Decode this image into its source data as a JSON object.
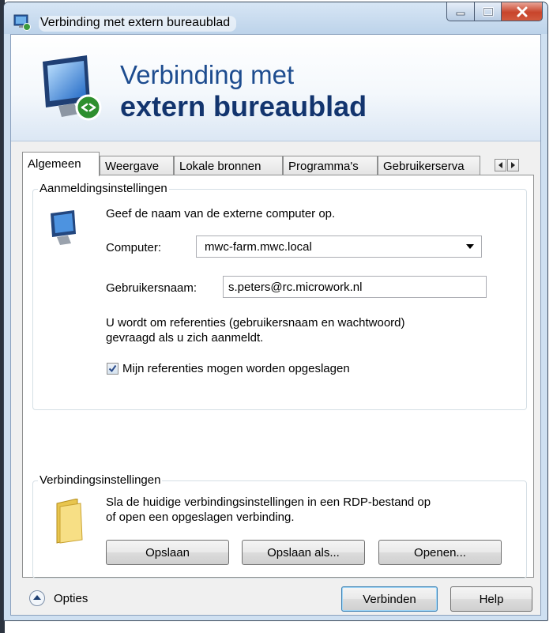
{
  "window": {
    "title": "Verbinding met extern bureaublad"
  },
  "banner": {
    "line1": "Verbinding met",
    "line2": "extern bureaublad"
  },
  "tabs": [
    {
      "label": "Algemeen",
      "active": true
    },
    {
      "label": "Weergave",
      "active": false
    },
    {
      "label": "Lokale bronnen",
      "active": false
    },
    {
      "label": "Programma's",
      "active": false
    },
    {
      "label": "Gebruikerserva",
      "active": false
    }
  ],
  "logon": {
    "legend": "Aanmeldingsinstellingen",
    "instruction": "Geef de naam van de externe computer op.",
    "computer_label": "Computer:",
    "computer_value": "mwc-farm.mwc.local",
    "username_label": "Gebruikersnaam:",
    "username_value": "s.peters@rc.microwork.nl",
    "note_line1": "U wordt om referenties (gebruikersnaam en wachtwoord)",
    "note_line2": "gevraagd als u zich aanmeldt.",
    "save_credentials_label": "Mijn referenties mogen worden opgeslagen",
    "save_credentials_checked": true
  },
  "connection": {
    "legend": "Verbindingsinstellingen",
    "desc_line1": "Sla de huidige verbindingsinstellingen in een RDP-bestand op",
    "desc_line2": "of open een opgeslagen verbinding.",
    "save_label": "Opslaan",
    "save_as_label": "Opslaan als...",
    "open_label": "Openen..."
  },
  "footer": {
    "options_label": "Opties",
    "connect_label": "Verbinden",
    "help_label": "Help"
  },
  "colors": {
    "banner_title": "#1d4c8f",
    "close_button": "#c8442b"
  }
}
